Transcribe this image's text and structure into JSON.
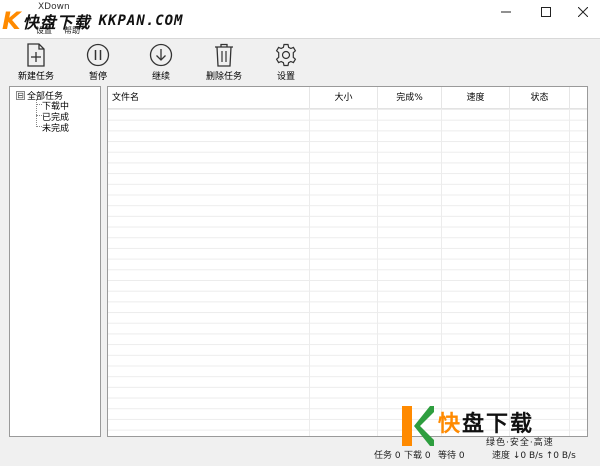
{
  "window": {
    "title": "XDown",
    "minimize_glyph": "—",
    "maximize_glyph": "☐",
    "close_glyph": "✕"
  },
  "watermark_top": {
    "logo_k": "K",
    "brand": "快盘下载",
    "url": "KKPAN.COM"
  },
  "menu": {
    "items": [
      "设置",
      "帮助"
    ]
  },
  "toolbar": {
    "new_task": "新建任务",
    "pause": "暂停",
    "resume": "继续",
    "delete_task": "删除任务",
    "settings": "设置"
  },
  "tree": {
    "toggle": "⊟",
    "root": "全部任务",
    "children": [
      "下载中",
      "已完成",
      "未完成"
    ]
  },
  "list": {
    "columns": [
      "文件名",
      "大小",
      "完成%",
      "速度",
      "状态"
    ]
  },
  "status": {
    "tasks": "任务 0",
    "downloading": "下载 0",
    "waiting": "等待 0",
    "speed": "速度 ↓0 B/s ↑0 B/s"
  },
  "watermark_bottom": {
    "brand_accent": "快",
    "brand_rest": "盘下载",
    "slogan": "绿色·安全·高速"
  },
  "colors": {
    "accent_orange": "#ff8a00",
    "accent_green": "#2e9e3f"
  }
}
